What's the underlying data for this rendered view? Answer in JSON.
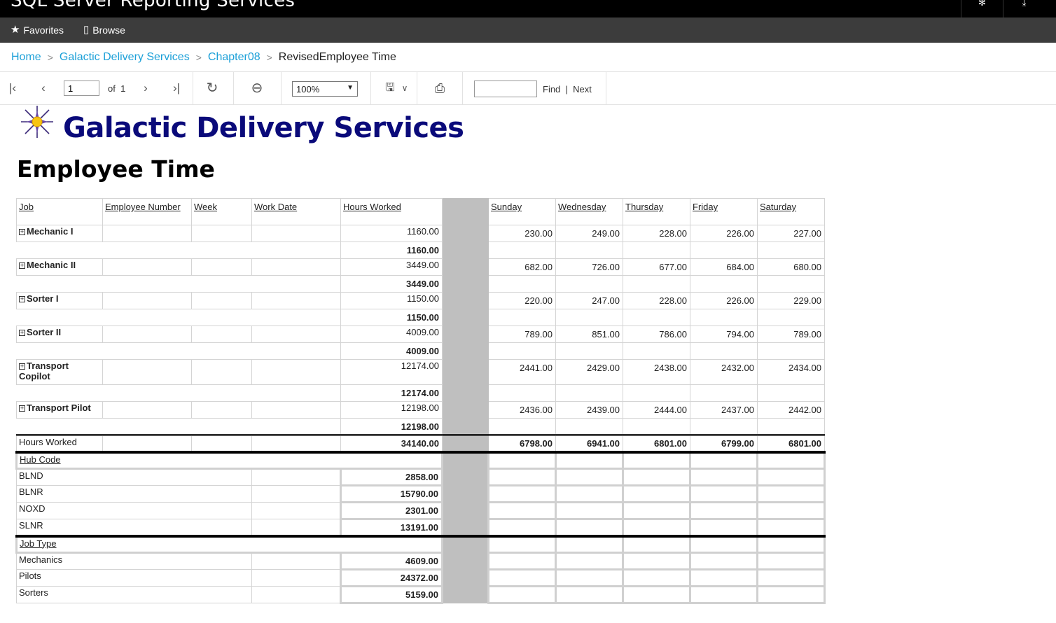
{
  "app": {
    "title": "SQL Server Reporting Services"
  },
  "nav": {
    "favorites": "Favorites",
    "browse": "Browse"
  },
  "breadcrumb": {
    "home": "Home",
    "folder1": "Galactic Delivery Services",
    "folder2": "Chapter08",
    "current": "RevisedEmployee Time"
  },
  "toolbar": {
    "page_value": "1",
    "of_label": "of",
    "total_pages": "1",
    "zoom": "100%",
    "find_value": "",
    "find_label": "Find",
    "separator": "|",
    "next_label": "Next"
  },
  "report": {
    "company": "Galactic Delivery Services",
    "title": "Employee Time",
    "headers": [
      "Job",
      "Employee Number",
      "Week",
      "Work Date",
      "Hours Worked",
      "Sunday",
      "Wednesday",
      "Thursday",
      "Friday",
      "Saturday"
    ],
    "jobs": [
      {
        "name": "Mechanic I",
        "hours": "1160.00",
        "subtotal": "1160.00",
        "days": [
          "230.00",
          "249.00",
          "228.00",
          "226.00",
          "227.00"
        ]
      },
      {
        "name": "Mechanic II",
        "hours": "3449.00",
        "subtotal": "3449.00",
        "days": [
          "682.00",
          "726.00",
          "677.00",
          "684.00",
          "680.00"
        ]
      },
      {
        "name": "Sorter I",
        "hours": "1150.00",
        "subtotal": "1150.00",
        "days": [
          "220.00",
          "247.00",
          "228.00",
          "226.00",
          "229.00"
        ]
      },
      {
        "name": "Sorter II",
        "hours": "4009.00",
        "subtotal": "4009.00",
        "days": [
          "789.00",
          "851.00",
          "786.00",
          "794.00",
          "789.00"
        ]
      },
      {
        "name": "Transport Copilot",
        "hours": "12174.00",
        "subtotal": "12174.00",
        "days": [
          "2441.00",
          "2429.00",
          "2438.00",
          "2432.00",
          "2434.00"
        ]
      },
      {
        "name": "Transport Pilot",
        "hours": "12198.00",
        "subtotal": "12198.00",
        "days": [
          "2436.00",
          "2439.00",
          "2444.00",
          "2437.00",
          "2442.00"
        ]
      }
    ],
    "total": {
      "label": "Hours Worked",
      "hours": "34140.00",
      "days": [
        "6798.00",
        "6941.00",
        "6801.00",
        "6799.00",
        "6801.00"
      ]
    },
    "hub_section": {
      "label": "Hub Code",
      "rows": [
        {
          "name": "BLND",
          "value": "2858.00"
        },
        {
          "name": "BLNR",
          "value": "15790.00"
        },
        {
          "name": "NOXD",
          "value": "2301.00"
        },
        {
          "name": "SLNR",
          "value": "13191.00"
        }
      ]
    },
    "jobtype_section": {
      "label": "Job Type",
      "rows": [
        {
          "name": "Mechanics",
          "value": "4609.00"
        },
        {
          "name": "Pilots",
          "value": "24372.00"
        },
        {
          "name": "Sorters",
          "value": "5159.00"
        }
      ]
    }
  },
  "colors": {
    "topbar": "#000000",
    "navbar": "#3c3c3c",
    "link": "#1ca0d8",
    "title": "#0a0a7a",
    "spacer": "#bfbfbf"
  },
  "icons": [
    "settings-icon",
    "download-icon",
    "star-icon",
    "browse-icon",
    "first-page-icon",
    "prev-page-icon",
    "next-page-icon",
    "last-page-icon",
    "refresh-icon",
    "back-icon",
    "save-icon",
    "print-icon",
    "logo-star-icon"
  ]
}
